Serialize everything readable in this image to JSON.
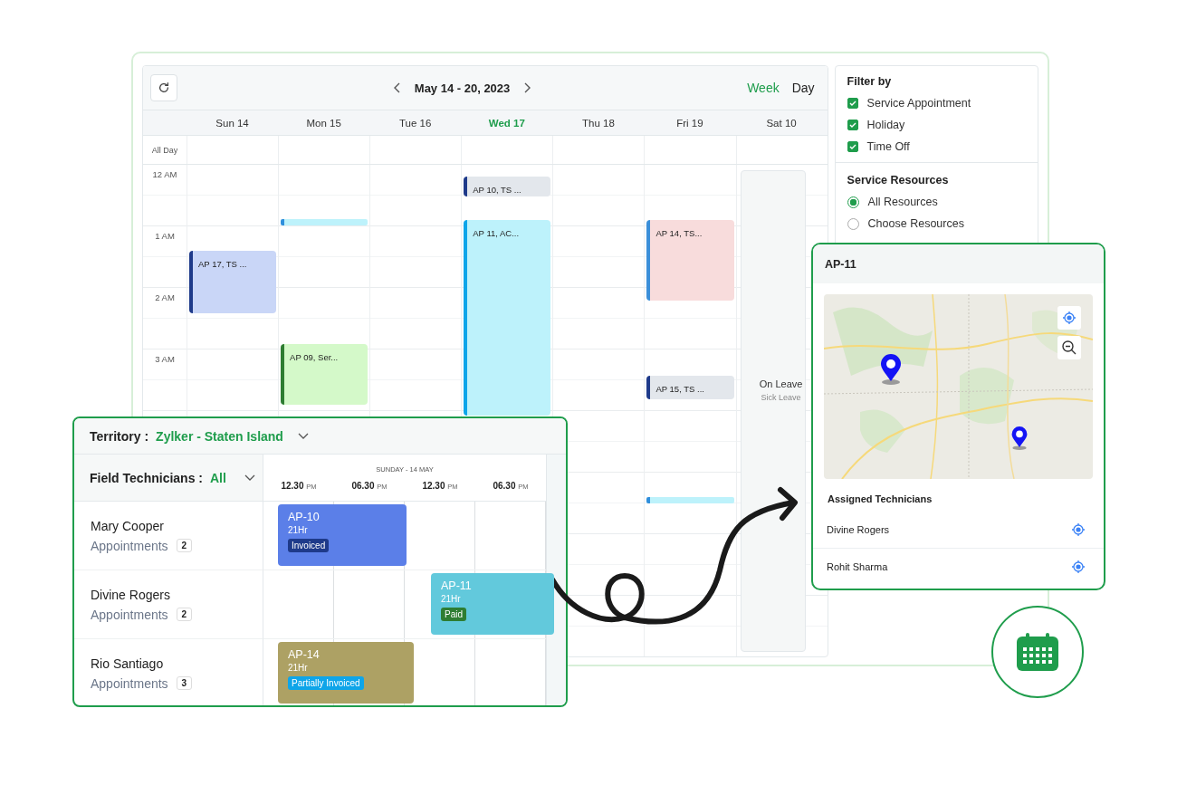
{
  "calendar": {
    "range": "May 14 - 20, 2023",
    "views": [
      {
        "label": "Week",
        "selected": true
      },
      {
        "label": "Day",
        "selected": false
      }
    ],
    "all_day_label": "All Day",
    "hours": [
      "12 AM",
      "1 AM",
      "2 AM",
      "3 AM"
    ],
    "days": [
      {
        "label": "Sun 14",
        "selected": false,
        "events": [
          {
            "kind": "appointment",
            "label": "AP 17, TS ...",
            "color": "#c9d6f7"
          }
        ]
      },
      {
        "label": "Mon 15",
        "selected": false,
        "events": [
          {
            "kind": "bar",
            "color": "#bdf2fb"
          },
          {
            "kind": "appointment",
            "label": "AP 09, Ser...",
            "color": "#d4f9c9"
          }
        ]
      },
      {
        "label": "Tue 16",
        "selected": false
      },
      {
        "label": "Wed 17",
        "selected": true,
        "events": [
          {
            "kind": "appointment",
            "label": "AP 10, TS ...",
            "color": "#e3e7ec"
          },
          {
            "kind": "appointment",
            "label": "AP 11, AC...",
            "color": "#bdf2fb"
          }
        ]
      },
      {
        "label": "Thu 18",
        "selected": false
      },
      {
        "label": "Fri 19",
        "selected": false,
        "events": [
          {
            "kind": "appointment",
            "label": "AP 14, TS...",
            "color": "#f8dcdc"
          },
          {
            "kind": "appointment",
            "label": "AP 15, TS ...",
            "color": "#e3e7ec"
          },
          {
            "kind": "bar",
            "color": "#bdf2fb"
          }
        ]
      },
      {
        "label": "Sat 10",
        "selected": false,
        "events": [
          {
            "kind": "leave",
            "label": "On Leave",
            "sublabel": "Sick Leave"
          }
        ]
      }
    ]
  },
  "filter": {
    "title": "Filter by",
    "options": [
      {
        "label": "Service Appointment",
        "checked": true
      },
      {
        "label": "Holiday",
        "checked": true
      },
      {
        "label": "Time Off",
        "checked": true
      }
    ],
    "resources_title": "Service Resources",
    "resources": [
      {
        "label": "All Resources",
        "selected": true
      },
      {
        "label": "Choose Resources",
        "selected": false
      }
    ]
  },
  "territory": {
    "label": "Territory :",
    "value": "Zylker - Staten Island",
    "technicians_label": "Field Technicians :",
    "technicians_value": "All",
    "date": "SUNDAY - 14 MAY",
    "times": [
      {
        "time": "12.30",
        "period": "PM"
      },
      {
        "time": "06.30",
        "period": "PM"
      },
      {
        "time": "12.30",
        "period": "PM"
      },
      {
        "time": "06.30",
        "period": "PM"
      }
    ],
    "rows": [
      {
        "name": "Mary Cooper",
        "appointments_label": "Appointments",
        "count": "2",
        "booking": {
          "id": "AP-10",
          "duration": "21Hr",
          "color": "#5b7fe8",
          "status": {
            "label": "Invoiced",
            "color": "#1e3a8a"
          }
        }
      },
      {
        "name": "Divine Rogers",
        "appointments_label": "Appointments",
        "count": "2",
        "booking": {
          "id": "AP-11",
          "duration": "21Hr",
          "color": "#62c9dc",
          "status": {
            "label": "Paid",
            "color": "#2e7d32"
          }
        }
      },
      {
        "name": "Rio Santiago",
        "appointments_label": "Appointments",
        "count": "3",
        "booking": {
          "id": "AP-14",
          "duration": "21Hr",
          "color": "#ada164",
          "status": {
            "label": "Partially Invoiced",
            "color": "#0ea5e9"
          }
        }
      }
    ]
  },
  "detail": {
    "title": "AP-11",
    "section": "Assigned Technicians",
    "technicians": [
      {
        "name": "Divine Rogers"
      },
      {
        "name": "Rohit Sharma"
      }
    ]
  }
}
